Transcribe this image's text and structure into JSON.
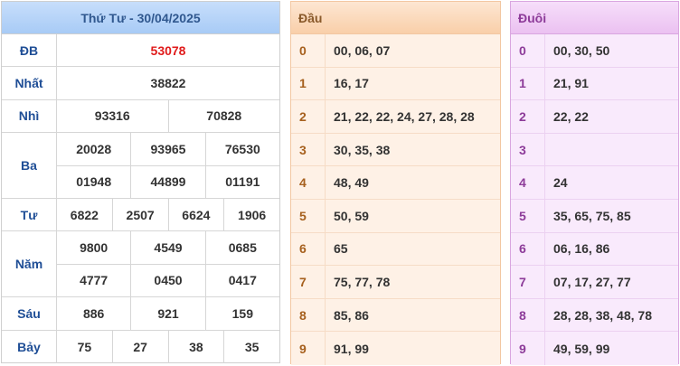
{
  "results": {
    "title": "Thứ Tư - 30/04/2025",
    "prizes": [
      {
        "label": "ĐB",
        "rows": [
          [
            "53078"
          ]
        ],
        "special": true
      },
      {
        "label": "Nhất",
        "rows": [
          [
            "38822"
          ]
        ]
      },
      {
        "label": "Nhì",
        "rows": [
          [
            "93316",
            "70828"
          ]
        ]
      },
      {
        "label": "Ba",
        "rows": [
          [
            "20028",
            "93965",
            "76530"
          ],
          [
            "01948",
            "44899",
            "01191"
          ]
        ]
      },
      {
        "label": "Tư",
        "rows": [
          [
            "6822",
            "2507",
            "6624",
            "1906"
          ]
        ]
      },
      {
        "label": "Năm",
        "rows": [
          [
            "9800",
            "4549",
            "0685"
          ],
          [
            "4777",
            "0450",
            "0417"
          ]
        ]
      },
      {
        "label": "Sáu",
        "rows": [
          [
            "886",
            "921",
            "159"
          ]
        ]
      },
      {
        "label": "Bảy",
        "rows": [
          [
            "75",
            "27",
            "38",
            "35"
          ]
        ]
      }
    ]
  },
  "dau": {
    "title": "Đầu",
    "rows": [
      {
        "digit": "0",
        "nums": "00, 06, 07"
      },
      {
        "digit": "1",
        "nums": "16, 17"
      },
      {
        "digit": "2",
        "nums": "21, 22, 22, 24, 27, 28, 28"
      },
      {
        "digit": "3",
        "nums": "30, 35, 38"
      },
      {
        "digit": "4",
        "nums": "48, 49"
      },
      {
        "digit": "5",
        "nums": "50, 59"
      },
      {
        "digit": "6",
        "nums": "65"
      },
      {
        "digit": "7",
        "nums": "75, 77, 78"
      },
      {
        "digit": "8",
        "nums": "85, 86"
      },
      {
        "digit": "9",
        "nums": "91, 99"
      }
    ]
  },
  "duoi": {
    "title": "Đuôi",
    "rows": [
      {
        "digit": "0",
        "nums": "00, 30, 50"
      },
      {
        "digit": "1",
        "nums": "21, 91"
      },
      {
        "digit": "2",
        "nums": "22, 22"
      },
      {
        "digit": "3",
        "nums": ""
      },
      {
        "digit": "4",
        "nums": "24"
      },
      {
        "digit": "5",
        "nums": "35, 65, 75, 85"
      },
      {
        "digit": "6",
        "nums": "06, 16, 86"
      },
      {
        "digit": "7",
        "nums": "07, 17, 27, 77"
      },
      {
        "digit": "8",
        "nums": "28, 28, 38, 48, 78"
      },
      {
        "digit": "9",
        "nums": "49, 59, 99"
      }
    ]
  },
  "colors": {
    "special_prize": "#e01b1b",
    "prize_label": "#1f4e96",
    "dau_header": "#f9cfa9",
    "duoi_header": "#ebc1f1"
  }
}
